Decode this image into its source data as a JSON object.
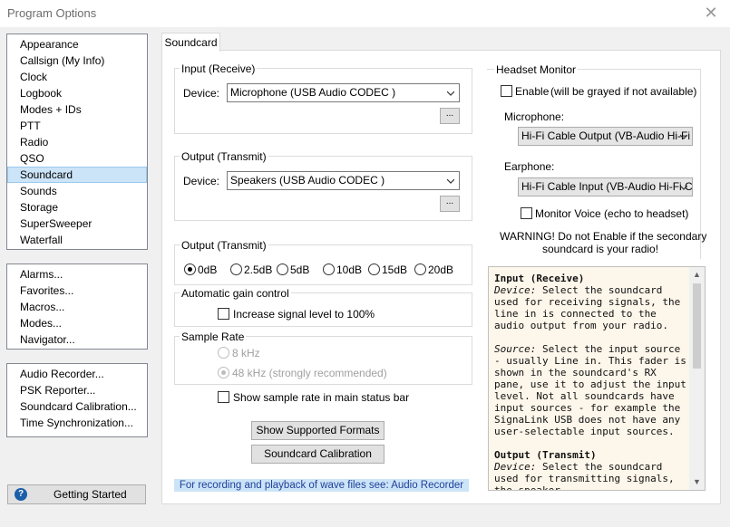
{
  "window": {
    "title": "Program Options"
  },
  "nav": {
    "group1": [
      "Appearance",
      "Callsign (My Info)",
      "Clock",
      "Logbook",
      "Modes + IDs",
      "PTT",
      "Radio",
      "QSO",
      "Soundcard",
      "Sounds",
      "Storage",
      "SuperSweeper",
      "Waterfall"
    ],
    "selected": "Soundcard",
    "group2": [
      "Alarms...",
      "Favorites...",
      "Macros...",
      "Modes...",
      "Navigator..."
    ],
    "group3": [
      "Audio Recorder...",
      "PSK Reporter...",
      "Soundcard Calibration...",
      "Time Synchronization..."
    ],
    "getting_started": "Getting Started"
  },
  "tab": {
    "label": "Soundcard"
  },
  "input": {
    "legend": "Input (Receive)",
    "device_label": "Device:",
    "device_value": "Microphone (USB Audio CODEC )",
    "browse": "..."
  },
  "output": {
    "legend": "Output (Transmit)",
    "device_label": "Device:",
    "device_value": "Speakers (USB Audio CODEC )",
    "browse": "..."
  },
  "output_level": {
    "legend": "Output (Transmit)",
    "options": [
      "0dB",
      "2.5dB",
      "5dB",
      "10dB",
      "15dB",
      "20dB"
    ],
    "selected": "0dB"
  },
  "agc": {
    "legend": "Automatic gain control",
    "checkbox": "Increase signal level to 100%",
    "checked": false
  },
  "sample_rate": {
    "legend": "Sample Rate",
    "options": [
      "8 kHz",
      "48 kHz (strongly recommended)"
    ],
    "selected": "48 kHz (strongly recommended)"
  },
  "status_bar_checkbox": {
    "label": "Show sample rate in main status bar",
    "checked": false
  },
  "buttons": {
    "show_formats": "Show Supported Formats",
    "calibration": "Soundcard Calibration"
  },
  "note": "For recording and playback of wave files see: Audio Recorder",
  "headset": {
    "legend": "Headset Monitor",
    "enable_label": "Enable",
    "enable_hint": "(will be grayed if not available)",
    "mic_label": "Microphone:",
    "mic_value": "Hi-Fi Cable Output (VB-Audio Hi-Fi C",
    "ear_label": "Earphone:",
    "ear_value": "Hi-Fi Cable Input (VB-Audio Hi-Fi Ca",
    "monitor_label": "Monitor Voice (echo to headset)",
    "warning_line1": "WARNING!  Do not Enable if the secondary",
    "warning_line2": "soundcard is your radio!"
  },
  "help": {
    "h1": "Input (Receive)",
    "p1_label": "Device:",
    "p1": " Select the soundcard used for receiving signals, the line in is connected to the audio output from your radio.",
    "p2_label": "Source:",
    "p2": " Select the input source - usually Line in. This fader is shown in the soundcard's RX pane, use it to adjust the input level. Not all soundcards have input sources - for example the SignaLink USB does not have any user-selectable input sources.",
    "h2": "Output (Transmit)",
    "p3_label": "Device:",
    "p3": " Select the soundcard used for transmitting signals, the speaker"
  }
}
